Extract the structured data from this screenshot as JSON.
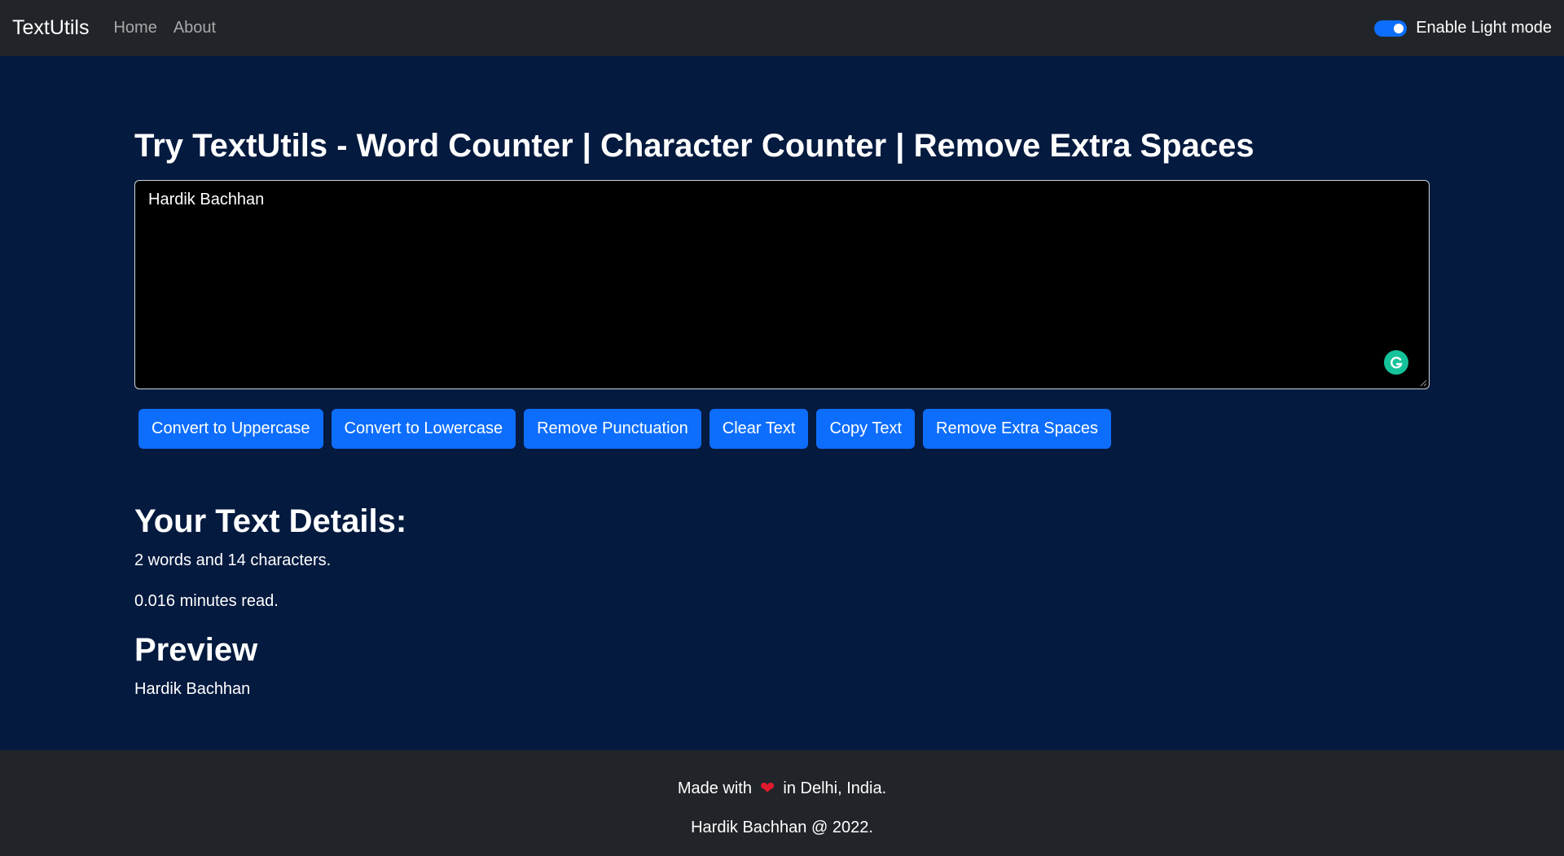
{
  "navbar": {
    "brand": "TextUtils",
    "links": [
      "Home",
      "About"
    ],
    "toggle_label": "Enable Light mode"
  },
  "main": {
    "title": "Try TextUtils - Word Counter | Character Counter | Remove Extra Spaces",
    "textarea_value": "Hardik Bachhan",
    "buttons": [
      "Convert to Uppercase",
      "Convert to Lowercase",
      "Remove Punctuation",
      "Clear Text",
      "Copy Text",
      "Remove Extra Spaces"
    ],
    "details_title": "Your Text Details:",
    "word_count_text": "2 words and 14 characters.",
    "read_time_text": "0.016 minutes read.",
    "preview_title": "Preview",
    "preview_text": "Hardik Bachhan"
  },
  "footer": {
    "made_with": "Made with",
    "location": "in Delhi, India.",
    "copyright": "Hardik Bachhan @ 2022."
  },
  "colors": {
    "background": "#041a3f",
    "navbar": "#212529",
    "button": "#0d6efd",
    "heart": "#e0192d"
  }
}
